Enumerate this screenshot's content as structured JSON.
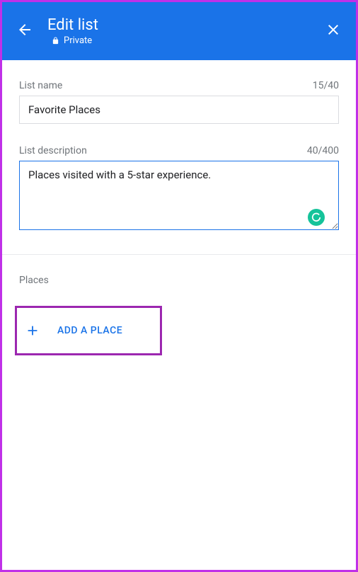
{
  "header": {
    "title": "Edit list",
    "privacy": "Private"
  },
  "fields": {
    "name": {
      "label": "List name",
      "value": "Favorite Places",
      "count": "15/40"
    },
    "description": {
      "label": "List description",
      "value": "Places visited with a 5-star experience.",
      "count": "40/400"
    }
  },
  "places": {
    "section_label": "Places",
    "add_button": "ADD A PLACE"
  }
}
